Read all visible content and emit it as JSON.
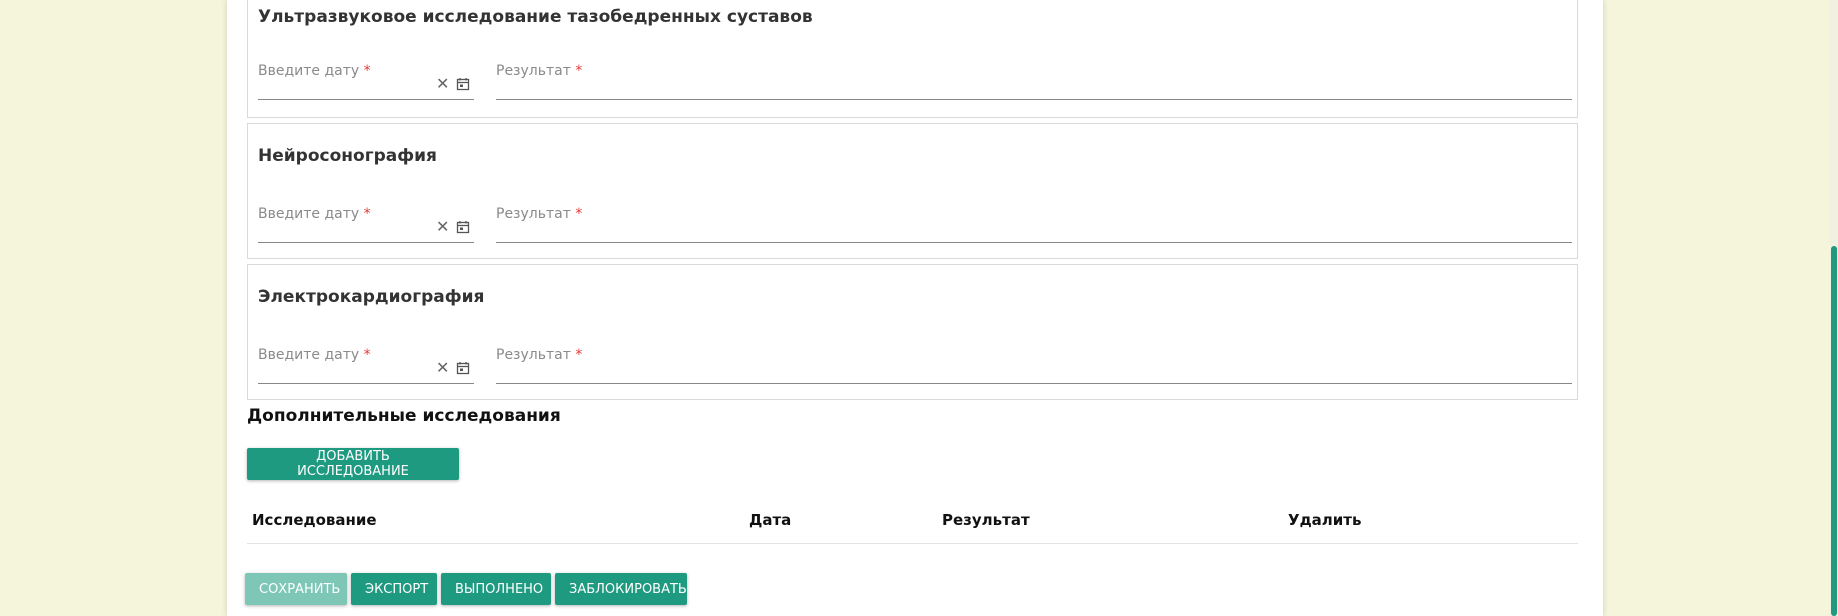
{
  "sections": [
    {
      "title": "Ультразвуковое исследование тазобедренных суставов",
      "date_label": "Введите дату",
      "result_label": "Результат",
      "required_mark": "*"
    },
    {
      "title": "Нейросонография",
      "date_label": "Введите дату",
      "result_label": "Результат",
      "required_mark": "*"
    },
    {
      "title": "Электрокардиография",
      "date_label": "Введите дату",
      "result_label": "Результат",
      "required_mark": "*"
    }
  ],
  "additional": {
    "title": "Дополнительные исследования",
    "add_button": "Добавить исследование",
    "columns": [
      "Исследование",
      "Дата",
      "Результат",
      "Удалить"
    ]
  },
  "actions": {
    "save": "Сохранить",
    "export": "Экспорт",
    "done": "Выполнено",
    "lock": "Заблокировать"
  },
  "icons": {
    "clear": "close-icon",
    "calendar": "calendar-icon"
  },
  "colors": {
    "accent": "#1e9a80",
    "accent_disabled": "#7ec7b7",
    "required": "#e53935",
    "background": "#f5f5dc"
  }
}
